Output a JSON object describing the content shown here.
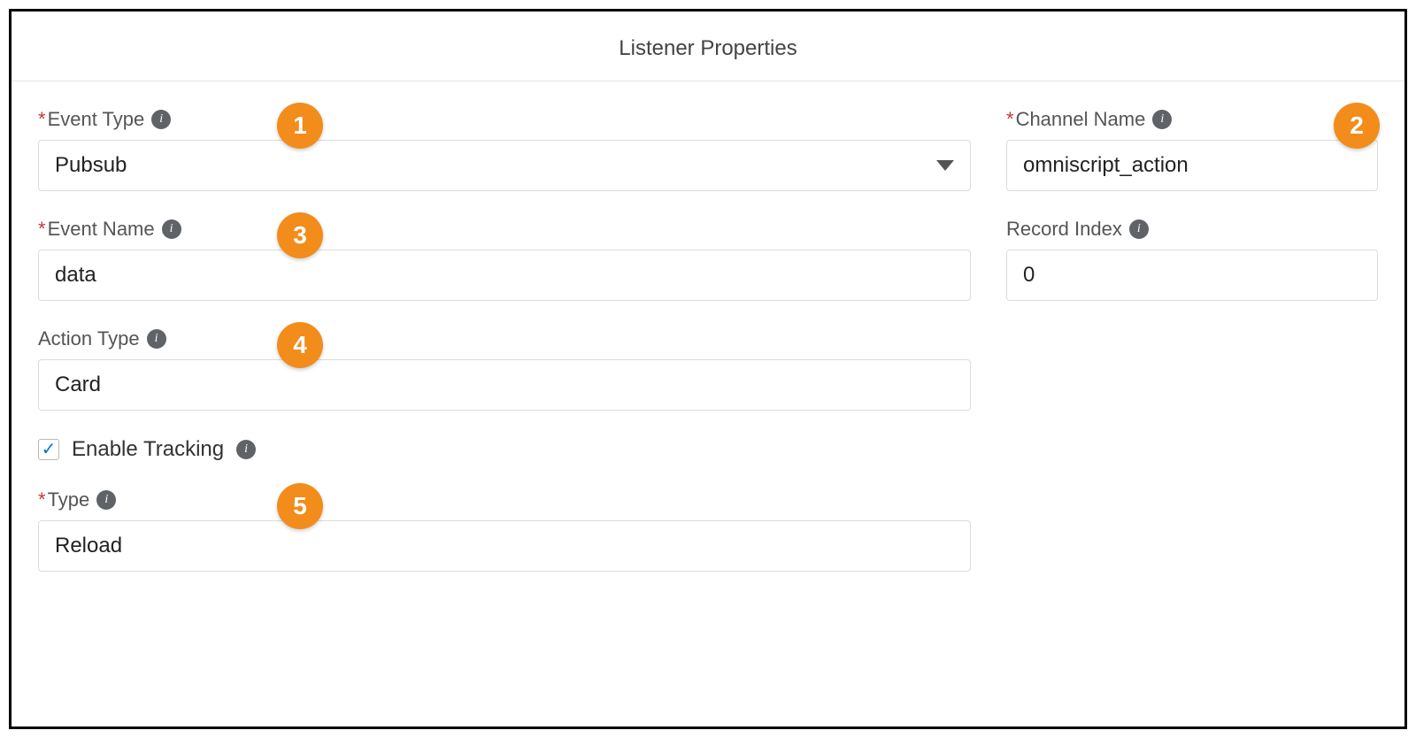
{
  "header": {
    "title": "Listener Properties"
  },
  "fields": {
    "eventType": {
      "label": "Event Type",
      "value": "Pubsub",
      "required": true
    },
    "channelName": {
      "label": "Channel Name",
      "value": "omniscript_action",
      "required": true
    },
    "eventName": {
      "label": "Event Name",
      "value": "data",
      "required": true
    },
    "recordIndex": {
      "label": "Record Index",
      "value": "0",
      "required": false
    },
    "actionType": {
      "label": "Action Type",
      "value": "Card",
      "required": false
    },
    "enableTracking": {
      "label": "Enable Tracking",
      "checked": true
    },
    "type": {
      "label": "Type",
      "value": "Reload",
      "required": true
    }
  },
  "badges": {
    "b1": "1",
    "b2": "2",
    "b3": "3",
    "b4": "4",
    "b5": "5"
  }
}
